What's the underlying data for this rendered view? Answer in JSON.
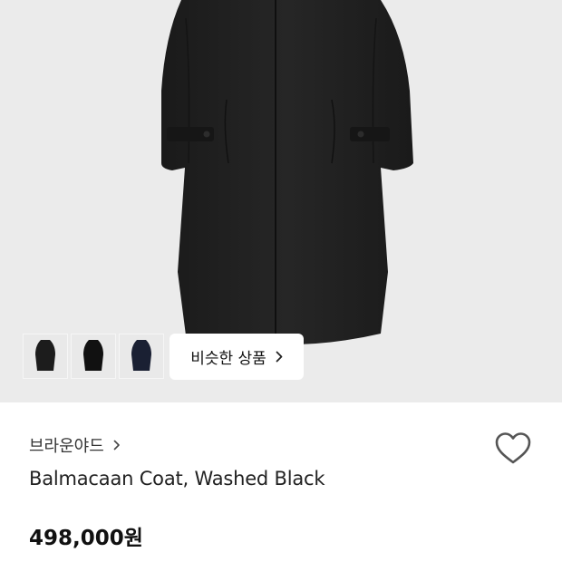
{
  "product": {
    "brand": "브라운야드",
    "title": "Balmacaan Coat, Washed Black",
    "price": "498,000원"
  },
  "gallery": {
    "similar_label": "비슷한 상품",
    "thumbnail_colors": [
      "#1c1c1c",
      "#111111",
      "#1a2033"
    ]
  },
  "icons": {
    "wishlist": "heart-outline-icon",
    "brand_chevron": "chevron-right-icon",
    "similar_chevron": "chevron-right-icon"
  },
  "colors": {
    "hero_bg": "#ebebeb",
    "coat": "#1e1e1e"
  }
}
